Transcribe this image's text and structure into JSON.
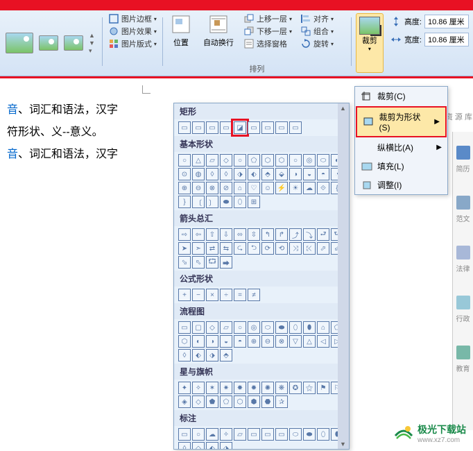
{
  "ribbon": {
    "pic_border": "图片边框",
    "pic_effect": "图片效果",
    "pic_format": "图片版式",
    "position": "位置",
    "auto_wrap": "自动换行",
    "bring_forward": "上移一层",
    "send_backward": "下移一层",
    "selection_pane": "选择窗格",
    "align": "对齐",
    "group": "组合",
    "rotate": "旋转",
    "arrange_label": "排列",
    "crop": "裁剪",
    "height_label": "高度:",
    "width_label": "宽度:",
    "height_val": "10.86 厘米",
    "width_val": "10.86 厘米"
  },
  "doc": {
    "line1a": "音",
    "line1b": "、词汇和语法，汉字",
    "line2": "符形状、义--意义。",
    "line3a": "音",
    "line3b": "、词汇和语法，汉字"
  },
  "shape_panel": {
    "cat_rect": "矩形",
    "cat_basic": "基本形状",
    "cat_arrow": "箭头总汇",
    "cat_formula": "公式形状",
    "cat_flow": "流程图",
    "cat_star": "星与旗帜",
    "cat_callout": "标注"
  },
  "crop_menu": {
    "crop": "裁剪(C)",
    "crop_shape": "裁剪为形状(S)",
    "aspect": "纵横比(A)",
    "fill": "填充(L)",
    "fit": "调整(I)"
  },
  "sidebar": {
    "resource": "资 源 库",
    "summary": "简历",
    "template": "范文",
    "legal": "法律",
    "admin": "行政",
    "edu": "教育"
  },
  "logo": {
    "name": "极光下载站",
    "url": "www.xz7.com"
  }
}
